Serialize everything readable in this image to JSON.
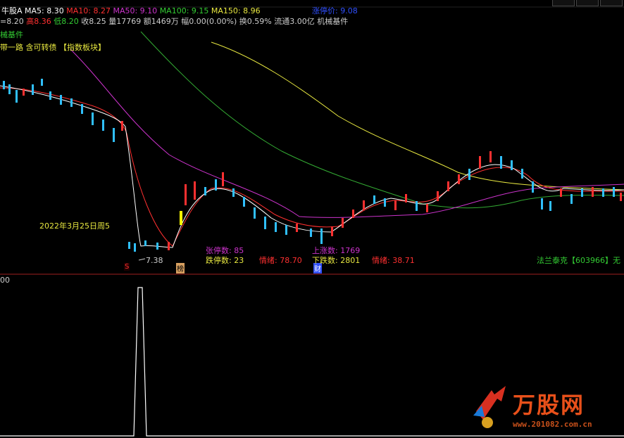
{
  "header": {
    "stock_name": "牛股A",
    "ma5": "MA5: 8.30",
    "ma10": "MA10: 8.27",
    "ma50": "MA50: 9.10",
    "ma100": "MA100: 9.15",
    "ma150": "MA150: 8.96",
    "limit_price": "涨停价: 9.08",
    "quote_line": {
      "open": "=8.20",
      "high": "高8.36",
      "low": "低8.20",
      "close": "收8.25",
      "volume": "量17769",
      "amount": "额1469万",
      "change": "幅0.00(0.00%)",
      "turnover": "换0.59%",
      "float": "流通3.00亿",
      "sector": "机械基件"
    },
    "sector_line": "械基件",
    "concept_line": "带一路 含可转债",
    "index_block": "【指数板块】"
  },
  "annotations": {
    "date_label": "2022年3月25日周5",
    "low_price": "7.38",
    "marker_s": "S",
    "marker_bang": "榜",
    "marker_cai": "财",
    "limit_up_count_label": "张停数:",
    "limit_up_count": "85",
    "limit_down_count_label": "跌停数:",
    "limit_down_count": "23",
    "sentiment1_label": "情绪:",
    "sentiment1": "78.70",
    "up_count_label": "上涨数:",
    "up_count": "1769",
    "down_count_label": "下跌数:",
    "down_count": "2801",
    "sentiment2_label": "情绪:",
    "sentiment2": "38.71",
    "stock_tag": "法兰泰克【603966】无"
  },
  "subchart": {
    "axis_label": "00"
  },
  "watermark": {
    "brand": "万股网",
    "url": "www.201082.com.cn"
  },
  "colors": {
    "ma5": "#ffffff",
    "ma10": "#ff3030",
    "ma50": "#cc33cc",
    "ma100": "#33aa33",
    "ma150": "#e8e840",
    "up": "#ff3030",
    "down": "#30c0ff",
    "limit": "#3050ff"
  }
}
